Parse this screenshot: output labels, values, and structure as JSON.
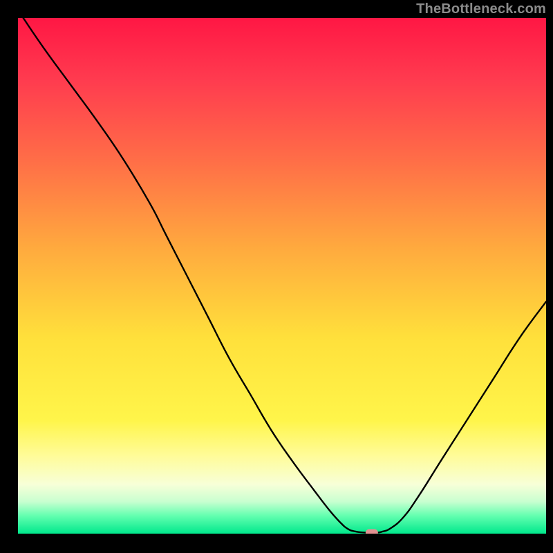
{
  "watermark": "TheBottleneck.com",
  "chart_data": {
    "type": "line",
    "title": "",
    "xlabel": "",
    "ylabel": "",
    "xlim": [
      0,
      100
    ],
    "ylim": [
      0,
      100
    ],
    "legend": null,
    "grid": false,
    "background": {
      "type": "vertical-gradient",
      "stops": [
        {
          "pos": 0.0,
          "color": "#ff1744"
        },
        {
          "pos": 0.12,
          "color": "#ff3b4f"
        },
        {
          "pos": 0.28,
          "color": "#ff6f47"
        },
        {
          "pos": 0.45,
          "color": "#ffab3e"
        },
        {
          "pos": 0.62,
          "color": "#ffe03b"
        },
        {
          "pos": 0.78,
          "color": "#fff54a"
        },
        {
          "pos": 0.85,
          "color": "#fffc9a"
        },
        {
          "pos": 0.905,
          "color": "#f7ffd8"
        },
        {
          "pos": 0.938,
          "color": "#c8ffd0"
        },
        {
          "pos": 0.965,
          "color": "#64ffb0"
        },
        {
          "pos": 1.0,
          "color": "#00e88c"
        }
      ]
    },
    "series": [
      {
        "name": "bottleneck-curve",
        "color": "#000000",
        "x": [
          1,
          5,
          10,
          15,
          20,
          25,
          28,
          32,
          36,
          40,
          44,
          48,
          52,
          56,
          59,
          61,
          62.5,
          64,
          66,
          68,
          69,
          70.5,
          73,
          76,
          80,
          85,
          90,
          95,
          100
        ],
        "y": [
          100,
          94,
          87,
          80,
          72.5,
          64,
          58,
          50,
          42,
          34,
          27,
          20,
          14,
          8.5,
          4.5,
          2.2,
          0.9,
          0.4,
          0.2,
          0.2,
          0.4,
          1.0,
          3.2,
          7.5,
          14,
          22,
          30,
          38,
          45
        ]
      }
    ],
    "marker": {
      "name": "optimal-point",
      "x": 67,
      "y": 0.2,
      "color": "#e29191",
      "shape": "rounded-pill"
    },
    "frame": {
      "inner_left": 26,
      "inner_top": 26,
      "inner_right": 790,
      "inner_bottom": 772,
      "axis_color": "#000000"
    }
  }
}
